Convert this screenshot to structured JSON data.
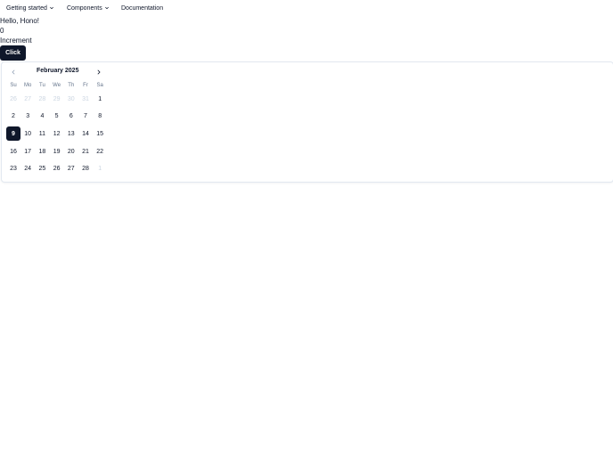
{
  "nav": {
    "items": [
      {
        "label": "Getting started",
        "has_chevron": true
      },
      {
        "label": "Components",
        "has_chevron": true
      },
      {
        "label": "Documentation",
        "has_chevron": false
      }
    ]
  },
  "content": {
    "greeting": "Hello, Hono!",
    "counter_value": "0",
    "increment_label": "Increment",
    "click_button_label": "Click"
  },
  "calendar": {
    "month_caption": "February 2025",
    "prev_icon": "chevron-left-icon",
    "next_icon": "chevron-right-icon",
    "weekdays": [
      "Su",
      "Mo",
      "Tu",
      "We",
      "Th",
      "Fr",
      "Sa"
    ],
    "weeks": [
      [
        {
          "d": "26",
          "outside": true
        },
        {
          "d": "27",
          "outside": true
        },
        {
          "d": "28",
          "outside": true
        },
        {
          "d": "29",
          "outside": true
        },
        {
          "d": "30",
          "outside": true
        },
        {
          "d": "31",
          "outside": true
        },
        {
          "d": "1"
        }
      ],
      [
        {
          "d": "2"
        },
        {
          "d": "3"
        },
        {
          "d": "4"
        },
        {
          "d": "5"
        },
        {
          "d": "6"
        },
        {
          "d": "7"
        },
        {
          "d": "8"
        }
      ],
      [
        {
          "d": "9",
          "selected": true
        },
        {
          "d": "10"
        },
        {
          "d": "11"
        },
        {
          "d": "12"
        },
        {
          "d": "13"
        },
        {
          "d": "14"
        },
        {
          "d": "15"
        }
      ],
      [
        {
          "d": "16"
        },
        {
          "d": "17"
        },
        {
          "d": "18"
        },
        {
          "d": "19"
        },
        {
          "d": "20"
        },
        {
          "d": "21"
        },
        {
          "d": "22"
        }
      ],
      [
        {
          "d": "23"
        },
        {
          "d": "24"
        },
        {
          "d": "25"
        },
        {
          "d": "26"
        },
        {
          "d": "27"
        },
        {
          "d": "28"
        },
        {
          "d": "1",
          "outside": true
        }
      ]
    ],
    "colors": {
      "selected_bg": "#0f172a",
      "selected_text": "#ffffff",
      "outside_text": "#cbd5e1",
      "weekday_text": "#64748b"
    }
  }
}
